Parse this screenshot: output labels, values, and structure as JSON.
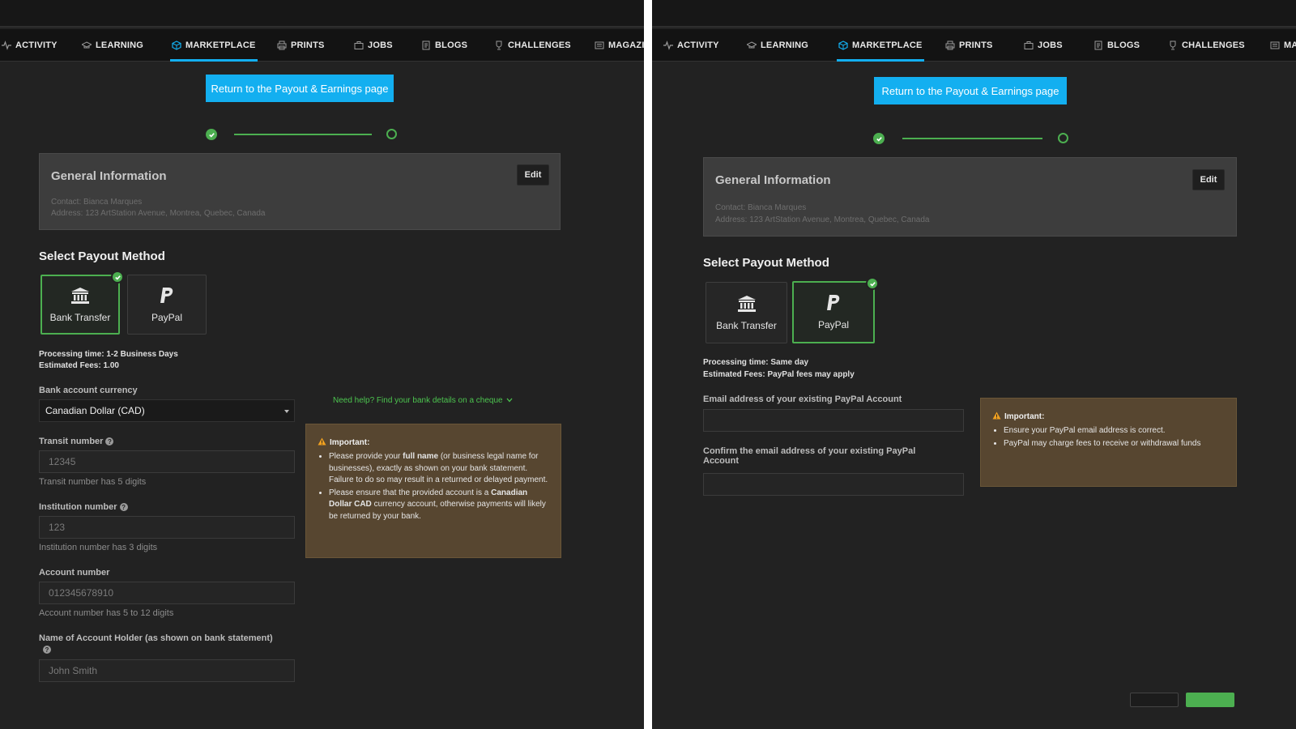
{
  "nav": {
    "items": [
      "ACTIVITY",
      "LEARNING",
      "MARKETPLACE",
      "PRINTS",
      "JOBS",
      "BLOGS",
      "CHALLENGES",
      "MAGAZINE"
    ],
    "active": "MARKETPLACE",
    "accent_color": "#13aff0"
  },
  "return_button": "Return to the Payout & Earnings page",
  "general_info": {
    "title": "General Information",
    "edit_label": "Edit",
    "contact_prefix": "Contact:",
    "contact_value": "Bianca Marques",
    "address_prefix": "Address:",
    "address_value": "123 ArtStation Avenue, Montrea, Quebec, Canada"
  },
  "payout": {
    "title": "Select Payout Method",
    "methods": [
      "Bank Transfer",
      "PayPal"
    ]
  },
  "bank_view": {
    "selected_method": "Bank Transfer",
    "processing_label": "Processing time:",
    "processing_value": "1-2 Business Days",
    "fees_label": "Estimated Fees:",
    "fees_value": "1.00",
    "currency_label": "Bank account currency",
    "currency_value": "Canadian Dollar (CAD)",
    "help_link": "Need help? Find your bank details on a cheque",
    "transit_label": "Transit number",
    "transit_placeholder": "12345",
    "transit_hint": "Transit number has 5 digits",
    "institution_label": "Institution number",
    "institution_placeholder": "123",
    "institution_hint": "Institution number has 3 digits",
    "account_label": "Account number",
    "account_placeholder": "012345678910",
    "account_hint": "Account number has 5 to 12 digits",
    "holder_label": "Name of Account Holder (as shown on bank statement)",
    "holder_placeholder": "John Smith",
    "important_title": "Important:",
    "important_1a": "Please provide your ",
    "important_1b": "full name",
    "important_1c": " (or business legal name for businesses), exactly as shown on your bank statement. Failure to do so may result in a returned or delayed payment.",
    "important_2a": "Please ensure that the provided account is a ",
    "important_2b": "Canadian Dollar CAD",
    "important_2c": " currency account, otherwise payments will likely be returned by your bank."
  },
  "paypal_view": {
    "selected_method": "PayPal",
    "processing_label": "Processing time:",
    "processing_value": "Same day",
    "fees_label": "Estimated Fees:",
    "fees_value": "PayPal fees may apply",
    "email_label": "Email address of your existing PayPal Account",
    "confirm_label_1": "Confirm the email address of your existing PayPal",
    "confirm_label_2": "Account",
    "important_title": "Important:",
    "important_1": "Ensure your PayPal email address is correct.",
    "important_2": "PayPal may charge fees to receive or withdrawal funds"
  },
  "colors": {
    "success": "#4caf50",
    "warning_bg": "#574630",
    "panel_bg": "#222222"
  }
}
